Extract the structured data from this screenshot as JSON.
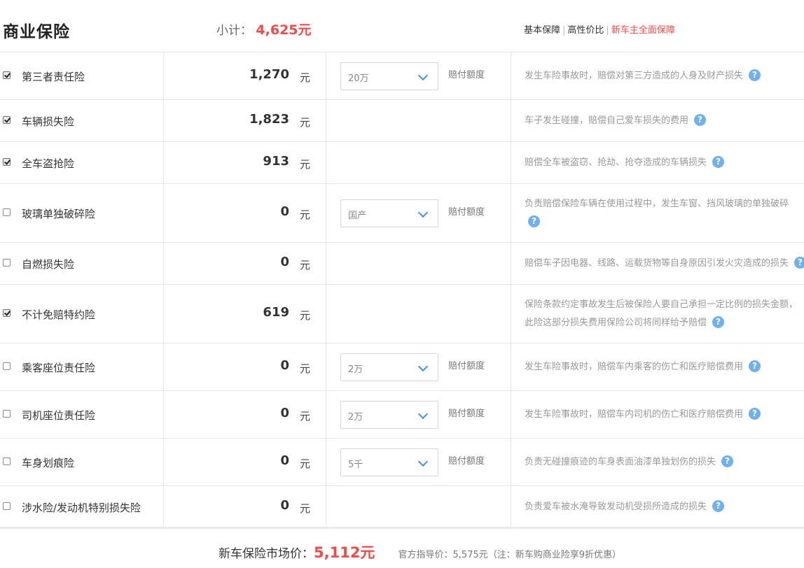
{
  "header": {
    "title": "商业保险",
    "subtotal_label": "小计：",
    "subtotal_value": "4,625元",
    "plans": [
      "基本保障",
      "高性价比",
      "新车主全面保障"
    ],
    "active_plan_index": 2,
    "separator": "|"
  },
  "rows": [
    {
      "checked": true,
      "name": "第三者责任险",
      "price": "1,270",
      "unit": "元",
      "select": "20万",
      "pay_label": "赔付额度",
      "desc": "发生车险事故时，赔偿对第三方造成的人身及财产损失",
      "desc2": ""
    },
    {
      "checked": true,
      "name": "车辆损失险",
      "price": "1,823",
      "unit": "元",
      "select": "",
      "pay_label": "",
      "desc": "车子发生碰撞，赔偿自己爱车损失的费用",
      "desc2": ""
    },
    {
      "checked": true,
      "name": "全车盗抢险",
      "price": "913",
      "unit": "元",
      "select": "",
      "pay_label": "",
      "desc": "赔偿全车被盗窃、抢劫、抢夺造成的车辆损失",
      "desc2": ""
    },
    {
      "checked": false,
      "name": "玻璃单独破碎险",
      "price": "0",
      "unit": "元",
      "select": "国产",
      "pay_label": "赔付额度",
      "desc": "负责赔偿保险车辆在使用过程中，发生车窗、挡风玻璃的单独破碎",
      "desc2": ""
    },
    {
      "checked": false,
      "name": "自燃损失险",
      "price": "0",
      "unit": "元",
      "select": "",
      "pay_label": "",
      "desc": "赔偿车子因电器、线路、运载货物等自身原因引发火灾造成的损失",
      "desc2": ""
    },
    {
      "checked": true,
      "name": "不计免赔特约险",
      "price": "619",
      "unit": "元",
      "select": "",
      "pay_label": "",
      "desc": "保险条款约定事故发生后被保险人要自己承担一定比例的损失金额，",
      "desc2": "此险这部分损失费用保险公司将同样给予赔偿"
    },
    {
      "checked": false,
      "name": "乘客座位责任险",
      "price": "0",
      "unit": "元",
      "select": "2万",
      "pay_label": "赔付额度",
      "desc": "发生车险事故时，赔偿车内乘客的伤亡和医疗赔偿费用",
      "desc2": ""
    },
    {
      "checked": false,
      "name": "司机座位责任险",
      "price": "0",
      "unit": "元",
      "select": "2万",
      "pay_label": "赔付额度",
      "desc": "发生车险事故时，赔偿车内司机的伤亡和医疗赔偿费用",
      "desc2": ""
    },
    {
      "checked": false,
      "name": "车身划痕险",
      "price": "0",
      "unit": "元",
      "select": "5千",
      "pay_label": "赔付额度",
      "desc": "负责无碰撞痕迹的车身表面油漆单独划伤的损失",
      "desc2": ""
    },
    {
      "checked": false,
      "name": "涉水险/发动机特别损失险",
      "price": "0",
      "unit": "元",
      "select": "",
      "pay_label": "",
      "desc": "负责爱车被水淹导致发动机受损所造成的损失",
      "desc2": ""
    }
  ],
  "help_glyph": "?",
  "footer": {
    "market_label": "新车保险市场价：",
    "market_value": "5,112元",
    "guide_text": "官方指导价：5,575元（注：新车购商业险享9折优惠）"
  },
  "colors": {
    "accent_red": "#f04a4a",
    "help_blue": "#6fb0ee",
    "chevron_blue": "#4a8fe0"
  }
}
